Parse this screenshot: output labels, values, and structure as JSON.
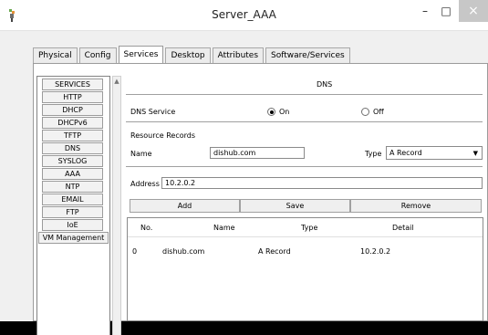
{
  "window": {
    "title": "Server_AAA",
    "minimize_glyph": "–",
    "maximize_glyph": "□",
    "close_glyph": "×",
    "app_icon": "packet-tracer-server-icon"
  },
  "tabs": [
    {
      "label": "Physical"
    },
    {
      "label": "Config"
    },
    {
      "label": "Services",
      "active": true
    },
    {
      "label": "Desktop"
    },
    {
      "label": "Attributes"
    },
    {
      "label": "Software/Services"
    }
  ],
  "services": {
    "items": [
      "SERVICES",
      "HTTP",
      "DHCP",
      "DHCPv6",
      "TFTP",
      "DNS",
      "SYSLOG",
      "AAA",
      "NTP",
      "EMAIL",
      "FTP",
      "IoE",
      "VM Management"
    ],
    "scroll_up_icon": "▲"
  },
  "dns": {
    "title": "DNS",
    "service_label": "DNS Service",
    "on_label": "On",
    "off_label": "Off",
    "service_state": "On",
    "records_label": "Resource Records",
    "name_label": "Name",
    "name_value": "dishub.com",
    "type_label": "Type",
    "type_value": "A Record",
    "dropdown_glyph": "▼",
    "address_label": "Address",
    "address_value": "10.2.0.2",
    "add_label": "Add",
    "save_label": "Save",
    "remove_label": "Remove",
    "table": {
      "headers": [
        "No.",
        "Name",
        "Type",
        "Detail"
      ],
      "rows": [
        [
          "0",
          "dishub.com",
          "A Record",
          "10.2.0.2"
        ]
      ]
    }
  },
  "colors": {
    "window_bg": "#f0f0f0",
    "titlebar_bg": "#ffffff",
    "close_button_bg": "#c7c7c7"
  }
}
